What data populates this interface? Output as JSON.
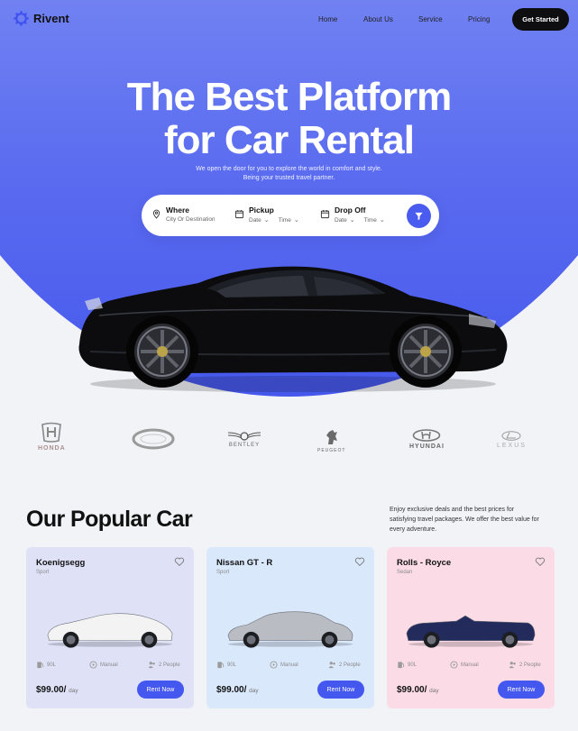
{
  "brand": {
    "name": "Rivent"
  },
  "nav": {
    "links": [
      "Home",
      "About Us",
      "Service",
      "Pricing"
    ],
    "cta": "Get Started"
  },
  "hero": {
    "headline_line1": "The Best Platform",
    "headline_line2": "for Car Rental",
    "subline_line1": "We open the door for you to explore the world in comfort and style.",
    "subline_line2": "Being your trusted travel partner."
  },
  "search": {
    "where": {
      "title": "Where",
      "placeholder": "City Or Destination"
    },
    "pickup": {
      "title": "Pickup",
      "date": "Date",
      "time": "Time"
    },
    "dropoff": {
      "title": "Drop Off",
      "date": "Date",
      "time": "Time"
    },
    "filter_icon": "filter-icon"
  },
  "brands": [
    "HONDA",
    "",
    "BENTLEY",
    "PEUGEOT",
    "HYUNDAI",
    "LEXUS"
  ],
  "popular": {
    "title": "Our Popular Car",
    "description_line1": "Enjoy exclusive deals and the best prices for",
    "description_line2": "satisfying travel packages. We offer the best value for",
    "description_line3": "every adventure.",
    "cards": [
      {
        "name": "Koenigsegg",
        "type": "Sport",
        "fuel": "90L",
        "transmission": "Manual",
        "capacity": "2 People",
        "price": "$99.00/",
        "per": "day",
        "cta": "Rent Now",
        "bg": "#dfe2f7",
        "car_color": "#f3f3f3"
      },
      {
        "name": "Nissan GT - R",
        "type": "Sport",
        "fuel": "90L",
        "transmission": "Manual",
        "capacity": "2 People",
        "price": "$99.00/",
        "per": "day",
        "cta": "Rent Now",
        "bg": "#d9e8fb",
        "car_color": "#b9bcc2"
      },
      {
        "name": "Rolls - Royce",
        "type": "Sedan",
        "fuel": "90L",
        "transmission": "Manual",
        "capacity": "2 People",
        "price": "$99.00/",
        "per": "day",
        "cta": "Rent Now",
        "bg": "#fbdce6",
        "car_color": "#232a5c"
      }
    ]
  },
  "colors": {
    "accent": "#4a5bef",
    "dark": "#0e0e10"
  }
}
